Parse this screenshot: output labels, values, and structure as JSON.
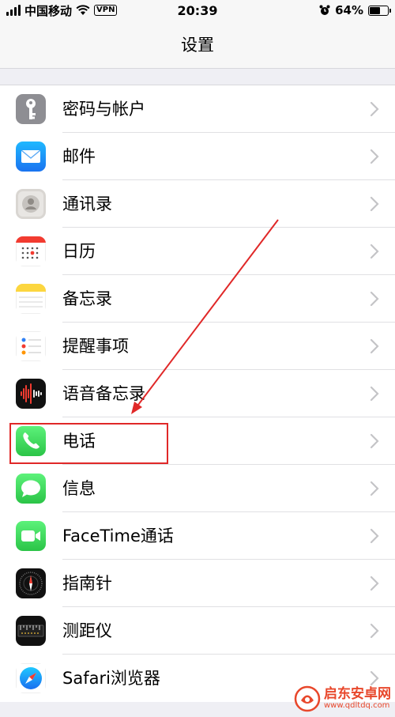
{
  "status_bar": {
    "carrier": "中国移动",
    "vpn": "VPN",
    "time": "20:39",
    "battery_percent": "64%",
    "battery_level": 0.64
  },
  "nav": {
    "title": "设置"
  },
  "items": [
    {
      "label": "密码与帐户",
      "icon": "key-icon"
    },
    {
      "label": "邮件",
      "icon": "mail-icon"
    },
    {
      "label": "通讯录",
      "icon": "contacts-icon"
    },
    {
      "label": "日历",
      "icon": "calendar-icon"
    },
    {
      "label": "备忘录",
      "icon": "notes-icon"
    },
    {
      "label": "提醒事项",
      "icon": "reminders-icon"
    },
    {
      "label": "语音备忘录",
      "icon": "voice-memos-icon"
    },
    {
      "label": "电话",
      "icon": "phone-icon"
    },
    {
      "label": "信息",
      "icon": "messages-icon"
    },
    {
      "label": "FaceTime通话",
      "icon": "facetime-icon"
    },
    {
      "label": "指南针",
      "icon": "compass-icon"
    },
    {
      "label": "测距仪",
      "icon": "measure-icon"
    },
    {
      "label": "Safari浏览器",
      "icon": "safari-icon"
    }
  ],
  "annotation": {
    "highlighted_item": "电话",
    "color": "#e02828"
  },
  "watermark": {
    "name": "启东安卓网",
    "url": "www.qdltdq.com"
  },
  "colors": {
    "accent_red": "#e02828",
    "watermark": "#e8472b"
  }
}
